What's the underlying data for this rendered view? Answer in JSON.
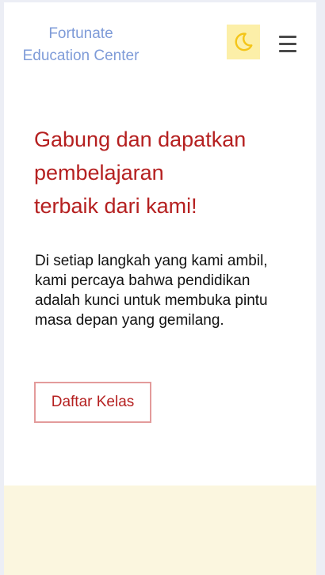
{
  "header": {
    "brand_line1": "Fortunate",
    "brand_line2": "Education Center",
    "theme_icon": "moon-icon",
    "menu_icon": "hamburger-icon"
  },
  "hero": {
    "title_line1": "Gabung dan dapatkan",
    "title_line2": "pembelajaran",
    "title_line3": "terbaik dari kami!",
    "description": "Di setiap langkah yang kami ambil, kami percaya bahwa pendidikan adalah kunci untuk membuka pintu masa depan yang gemilang.",
    "cta_label": "Daftar Kelas"
  },
  "colors": {
    "brand": "#7e9bd8",
    "accent": "#b52020",
    "toggle_bg": "#fcefa8",
    "moon": "#f4c518",
    "band": "#fbf6df"
  }
}
